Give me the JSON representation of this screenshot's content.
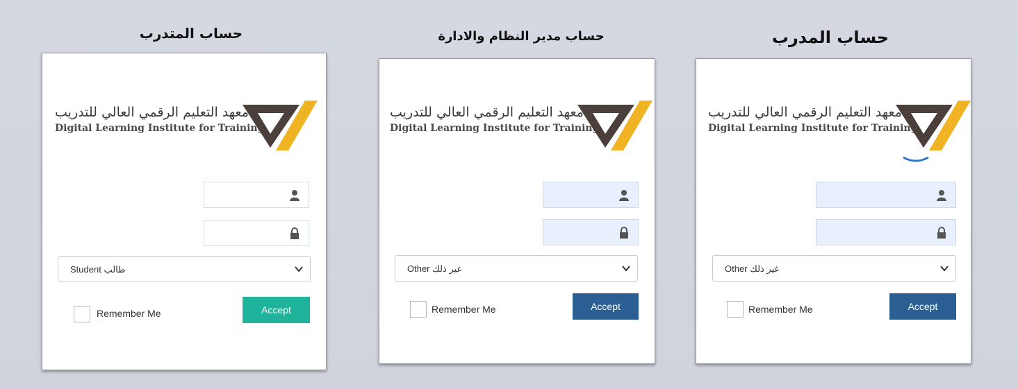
{
  "panels": [
    {
      "title": "حساب المتدرب",
      "logo": {
        "arabic": "معهد التعليم الرقمي العالي للتدريب",
        "english": "Digital Learning Institute for Training"
      },
      "role_select": {
        "value": "Student طالب",
        "options_visible": [
          "Student طالب"
        ]
      },
      "remember_label": "Remember Me",
      "accept_label": "Accept"
    },
    {
      "title": "حساب مدير النظام والادارة",
      "logo": {
        "arabic": "معهد التعليم الرقمي العالي للتدريب",
        "english": "Digital Learning Institute for Training"
      },
      "role_select": {
        "value": "Other غير ذلك",
        "options_visible": [
          "Other غير ذلك"
        ]
      },
      "remember_label": "Remember Me",
      "accept_label": "Accept"
    },
    {
      "title": "حساب المدرب",
      "logo": {
        "arabic": "معهد التعليم الرقمي العالي للتدريب",
        "english": "Digital Learning Institute for Training"
      },
      "role_select": {
        "value": "Other غير ذلك",
        "options_visible": [
          "Other غير ذلك"
        ]
      },
      "remember_label": "Remember Me",
      "accept_label": "Accept"
    }
  ],
  "icons": {
    "username": "user-icon",
    "password": "lock-icon",
    "dropdown": "chevron-down-icon",
    "logo": "institute-logo-mark"
  },
  "colors": {
    "accept_teal": "#1fb39b",
    "accept_navy": "#2b5f94",
    "logo_dark": "#4a3f3a",
    "logo_gold": "#f0b323",
    "autofill_tint": "#e8f0fe"
  }
}
